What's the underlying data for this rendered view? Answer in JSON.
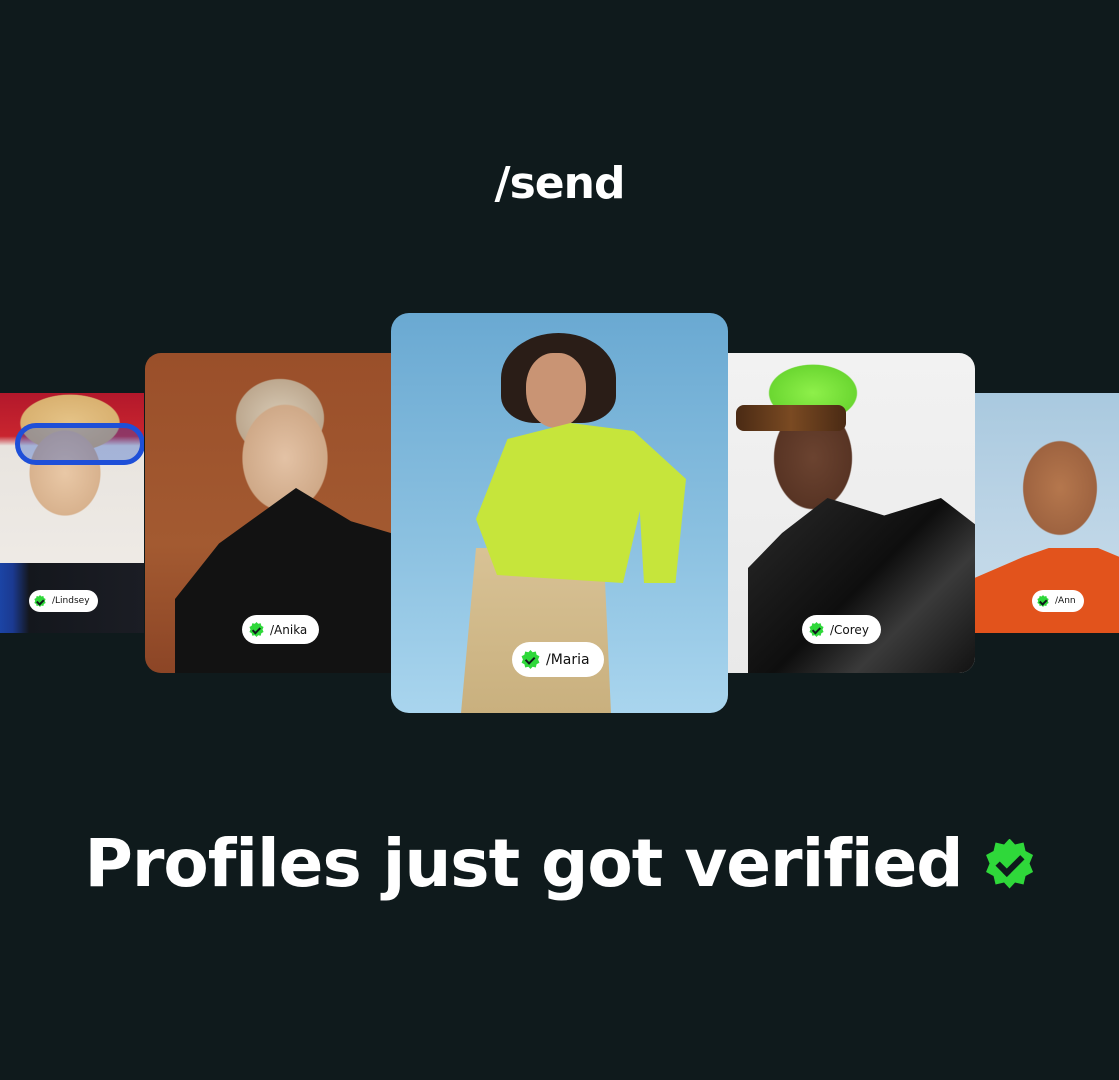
{
  "brand": {
    "logo_text": "/send"
  },
  "profiles": [
    {
      "handle": "/Lindsey",
      "verified": true
    },
    {
      "handle": "/Anika",
      "verified": true
    },
    {
      "handle": "/Maria",
      "verified": true
    },
    {
      "handle": "/Corey",
      "verified": true
    },
    {
      "handle": "/Ann",
      "verified": true
    }
  ],
  "headline": {
    "text": "Profiles just got verified",
    "badge_icon": "verified-badge-icon"
  },
  "colors": {
    "background": "#0f1a1c",
    "verified_green": "#2fd83a",
    "text": "#ffffff"
  }
}
